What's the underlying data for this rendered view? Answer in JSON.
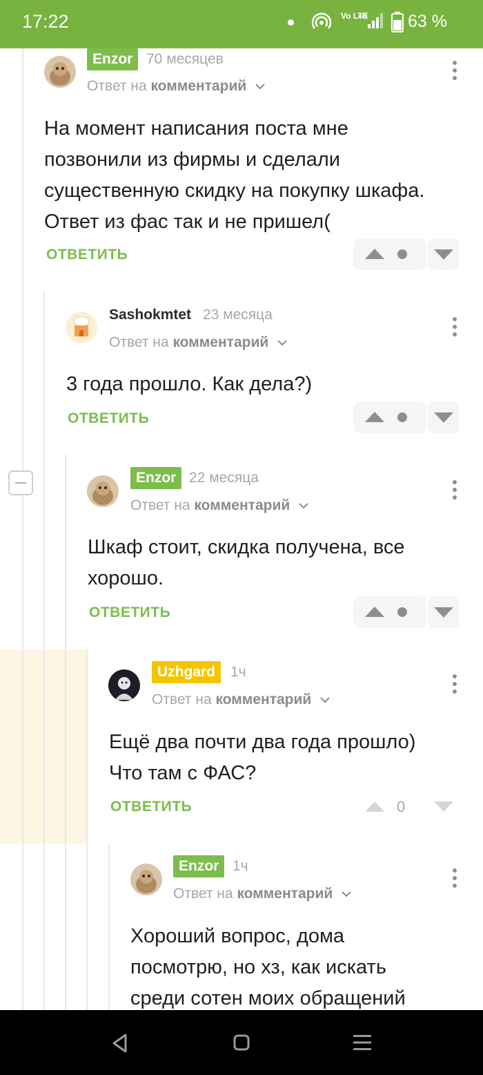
{
  "status_bar": {
    "time": "17:22",
    "network_label": "Vo LTE",
    "network_type": "4G",
    "battery": "63 %"
  },
  "comments": [
    {
      "user": "Enzor",
      "time": "70 месяцев",
      "reply_prefix": "Ответ на",
      "reply_target": "комментарий",
      "lines": [
        "На момент написания поста мне",
        "позвонили из фирмы и сделали",
        "существенную скидку на покупку шкафа.",
        "Ответ из фас так и не пришел("
      ],
      "reply_label": "ОТВЕТИТЬ"
    },
    {
      "user": "Sashokmtet",
      "time": "23 месяца",
      "reply_prefix": "Ответ на",
      "reply_target": "комментарий",
      "lines": [
        "3 года прошло. Как дела?)"
      ],
      "reply_label": "ОТВЕТИТЬ"
    },
    {
      "user": "Enzor",
      "time": "22 месяца",
      "reply_prefix": "Ответ на",
      "reply_target": "комментарий",
      "lines": [
        "Шкаф стоит, скидка получена, все",
        "хорошо."
      ],
      "reply_label": "ОТВЕТИТЬ"
    },
    {
      "user": "Uzhgard",
      "time": "1ч",
      "reply_prefix": "Ответ на",
      "reply_target": "комментарий",
      "lines": [
        "Ещё два почти два года прошло)",
        "Что там с ФАС?"
      ],
      "reply_label": "ОТВЕТИТЬ",
      "score": "0"
    },
    {
      "user": "Enzor",
      "time": "1ч",
      "reply_prefix": "Ответ на",
      "reply_target": "комментарий",
      "lines": [
        "Хороший вопрос, дома",
        "посмотрю, но хз, как искать",
        "среди сотен моих обращений"
      ]
    }
  ],
  "colors": {
    "status_bar": "#79b33f",
    "badge_green": "#7cbd4c",
    "badge_yellow": "#f5c400",
    "highlight": "#fdf6e3"
  }
}
